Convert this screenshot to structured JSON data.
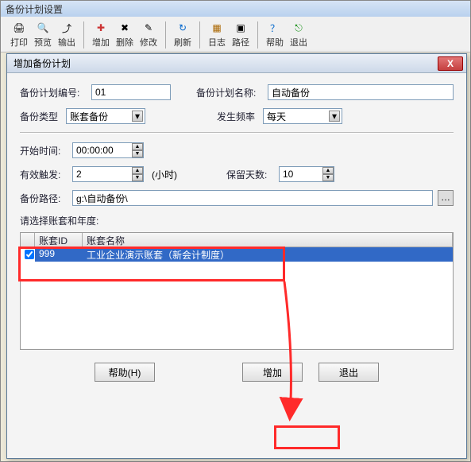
{
  "window": {
    "title": "备份计划设置"
  },
  "toolbar": {
    "print": "打印",
    "preview": "预览",
    "export": "输出",
    "add": "增加",
    "delete": "删除",
    "edit": "修改",
    "refresh": "刷新",
    "log": "日志",
    "path": "路径",
    "help": "帮助",
    "exit": "退出"
  },
  "dialog": {
    "title": "增加备份计划",
    "labels": {
      "plan_no": "备份计划编号:",
      "plan_name": "备份计划名称:",
      "backup_type": "备份类型",
      "frequency": "发生频率",
      "start_time": "开始时间:",
      "trigger": "有效触发:",
      "hours_unit": "(小时)",
      "retain_days": "保留天数:",
      "backup_path": "备份路径:",
      "select_account": "请选择账套和年度:",
      "col_cb": "",
      "col_id": "账套ID",
      "col_name": "账套名称"
    },
    "values": {
      "plan_no": "01",
      "plan_name": "自动备份",
      "backup_type": "账套备份",
      "frequency": "每天",
      "start_time": "00:00:00",
      "trigger": "2",
      "retain_days": "10",
      "backup_path": "g:\\自动备份\\"
    },
    "rows": [
      {
        "id": "999",
        "name": "工业企业演示账套（新会计制度）",
        "checked": true
      }
    ],
    "buttons": {
      "help": "帮助(H)",
      "add": "增加",
      "exit": "退出",
      "browse": "…",
      "close": "X"
    }
  }
}
